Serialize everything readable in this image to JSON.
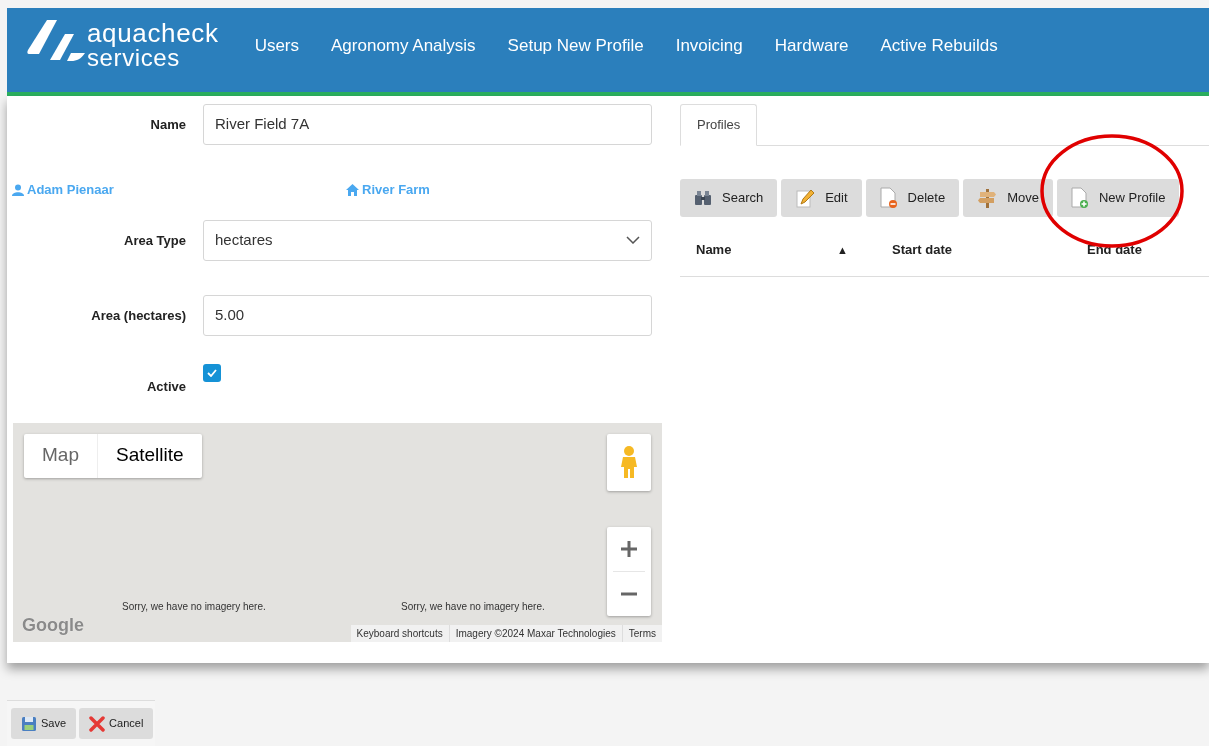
{
  "header": {
    "logo": {
      "line1": "aquacheck",
      "line2": "services"
    },
    "nav": [
      {
        "label": "Users"
      },
      {
        "label": "Agronomy Analysis"
      },
      {
        "label": "Setup New Profile"
      },
      {
        "label": "Invoicing"
      },
      {
        "label": "Hardware"
      },
      {
        "label": "Active Rebuilds"
      }
    ]
  },
  "form": {
    "name": {
      "label": "Name",
      "value": "River Field 7A"
    },
    "links": [
      {
        "kind": "user",
        "label": "Adam Pienaar"
      },
      {
        "kind": "home",
        "label": "River Farm"
      }
    ],
    "area_type": {
      "label": "Area Type",
      "value": "hectares"
    },
    "area": {
      "label": "Area (hectares)",
      "value": "5.00"
    },
    "active": {
      "label": "Active",
      "checked": true
    }
  },
  "map": {
    "type_buttons": [
      {
        "label": "Map",
        "selected": false
      },
      {
        "label": "Satellite",
        "selected": true
      }
    ],
    "messages": [
      "Sorry, we have no imagery here.",
      "Sorry, we have no imagery here."
    ],
    "logo": "Google",
    "attribution": [
      "Keyboard shortcuts",
      "Imagery ©2024 Maxar Technologies",
      "Terms"
    ]
  },
  "profiles": {
    "tabs": [
      {
        "label": "Profiles",
        "selected": true
      }
    ],
    "toolbar": [
      {
        "kind": "search",
        "label": "Search"
      },
      {
        "kind": "edit",
        "label": "Edit"
      },
      {
        "kind": "delete",
        "label": "Delete"
      },
      {
        "kind": "move",
        "label": "Move"
      },
      {
        "kind": "new",
        "label": "New Profile",
        "highlighted": true
      }
    ],
    "columns": [
      {
        "label": "Name",
        "sort_indicator": "▲"
      },
      {
        "label": "Start date"
      },
      {
        "label": "End date"
      }
    ]
  },
  "footer_buttons": [
    {
      "kind": "save",
      "label": "Save"
    },
    {
      "kind": "cancel",
      "label": "Cancel"
    }
  ]
}
